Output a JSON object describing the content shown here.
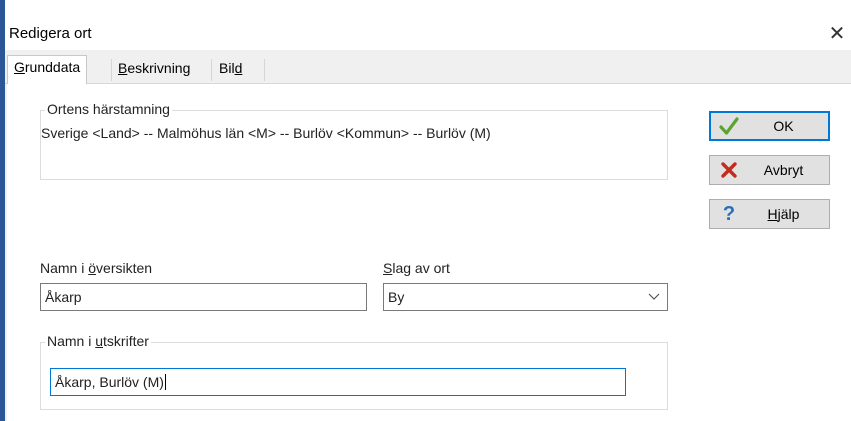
{
  "window": {
    "title": "Redigera ort",
    "close_glyph": "✕"
  },
  "tabs": [
    {
      "pre": "",
      "mn": "G",
      "post": "runddata"
    },
    {
      "pre": "",
      "mn": "B",
      "post": "eskrivning"
    },
    {
      "pre": "Bil",
      "mn": "d",
      "post": ""
    }
  ],
  "origin": {
    "legend": "Ortens härstamning",
    "text": "Sverige <Land> -- Malmöhus län <M> -- Burlöv <Kommun> -- Burlöv (M)"
  },
  "buttons": {
    "ok": {
      "label": "OK",
      "icon": "checkmark-icon"
    },
    "cancel": {
      "label": "Avbryt",
      "icon": "red-x-icon"
    },
    "help": {
      "pre": "",
      "mn": "H",
      "post": "jälp",
      "icon": "question-mark-icon"
    }
  },
  "overview_name": {
    "label_pre": "Namn i ",
    "label_mn": "ö",
    "label_post": "versikten",
    "value": "Åkarp"
  },
  "place_type": {
    "label_pre": "",
    "label_mn": "S",
    "label_post": "lag av ort",
    "value": "By"
  },
  "print_name": {
    "legend_pre": "Namn i ",
    "legend_mn": "u",
    "legend_post": "tskrifter",
    "value": "Åkarp, Burlöv (M)"
  },
  "colors": {
    "accent": "#0078d7",
    "ok_check": "#5aa530",
    "cancel_x": "#c42b1c",
    "help_q": "#2a6ebb",
    "window_edge": "#2b5797"
  }
}
